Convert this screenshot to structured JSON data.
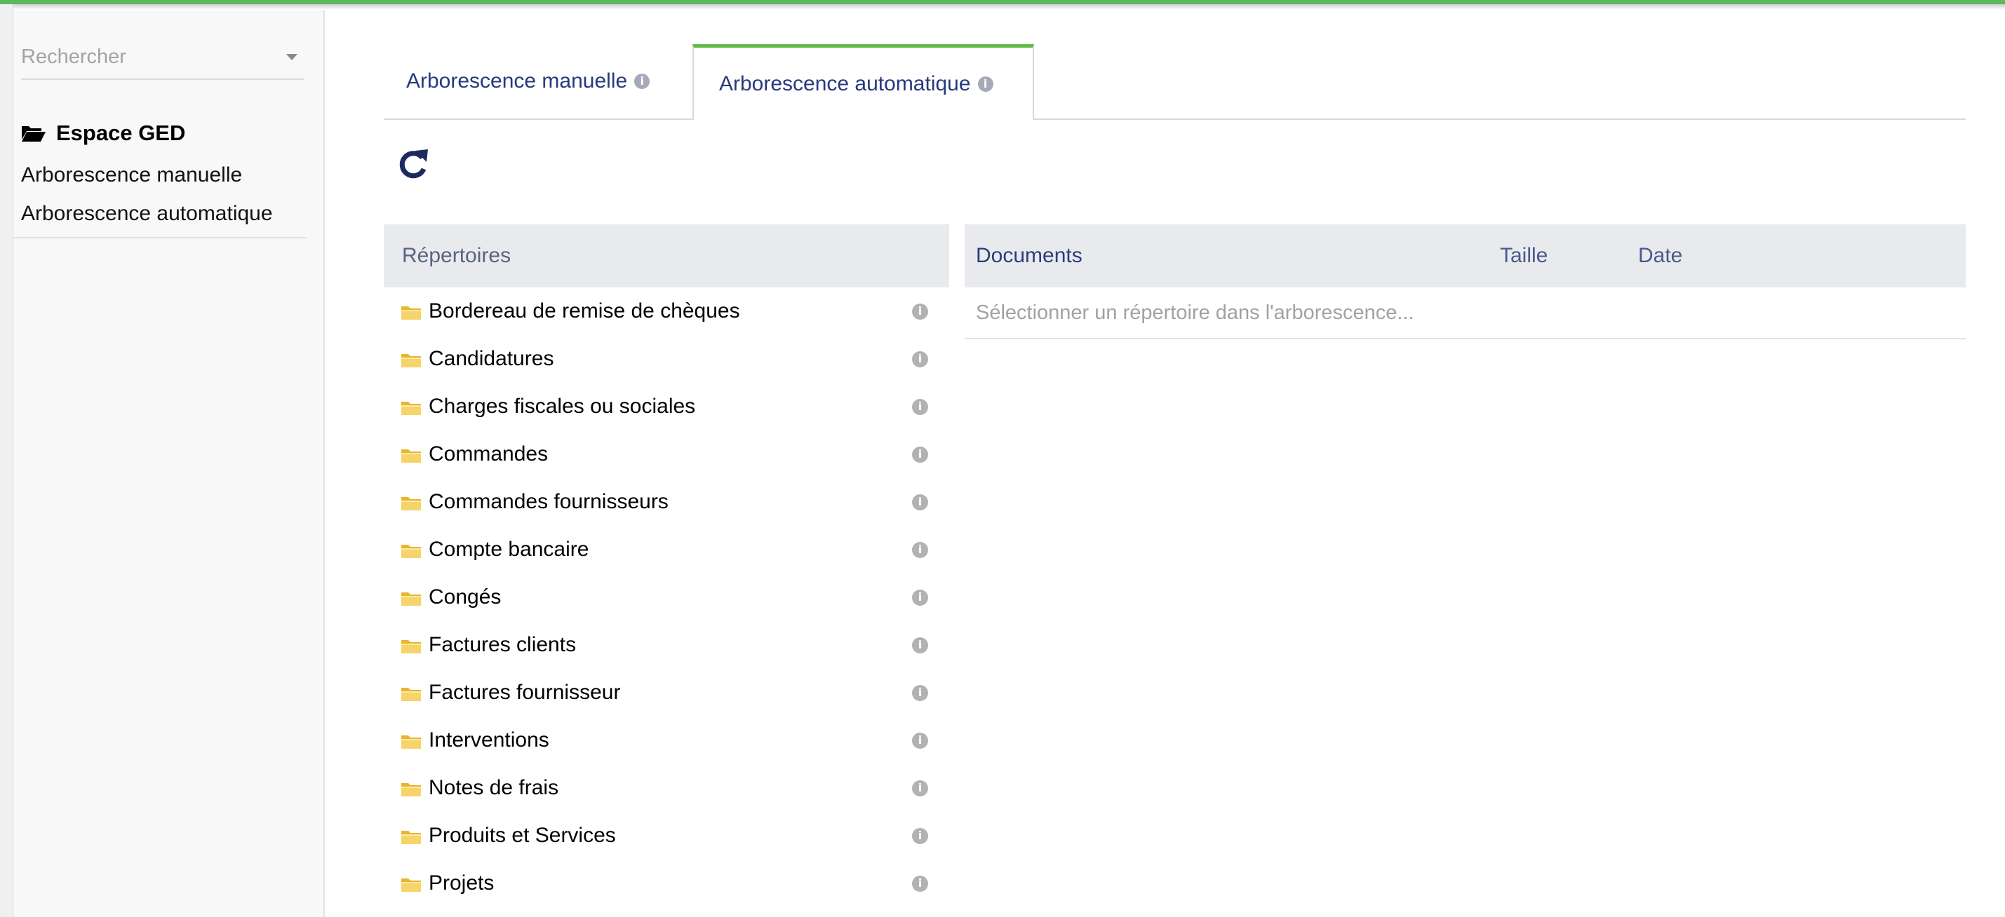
{
  "sidebar": {
    "search_placeholder": "Rechercher",
    "section_title": "Espace GED",
    "links": [
      "Arborescence manuelle",
      "Arborescence automatique"
    ]
  },
  "tabs": [
    {
      "label": "Arborescence manuelle",
      "active": false
    },
    {
      "label": "Arborescence automatique",
      "active": true
    }
  ],
  "repertoires": {
    "header": "Répertoires",
    "folders": [
      "Bordereau de remise de chèques",
      "Candidatures",
      "Charges fiscales ou sociales",
      "Commandes",
      "Commandes fournisseurs",
      "Compte bancaire",
      "Congés",
      "Factures clients",
      "Factures fournisseur",
      "Interventions",
      "Notes de frais",
      "Produits et Services",
      "Projets"
    ]
  },
  "documents": {
    "headers": {
      "documents": "Documents",
      "taille": "Taille",
      "date": "Date"
    },
    "empty_message": "Sélectionner un répertoire dans l'arborescence..."
  },
  "colors": {
    "accent_green": "#62bb46",
    "link_blue": "#263a7e",
    "folder_yellow": "#f4c542"
  }
}
